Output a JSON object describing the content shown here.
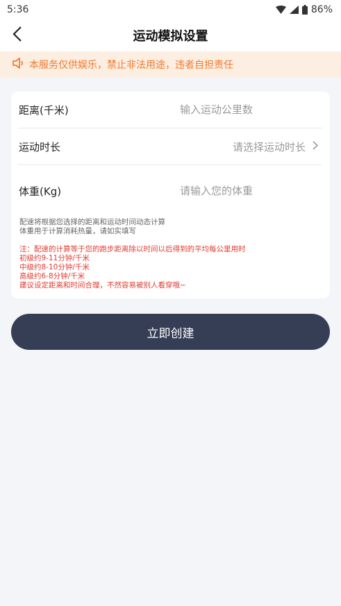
{
  "status_bar": {
    "time": "5:36",
    "battery": "86%"
  },
  "nav": {
    "title": "运动模拟设置"
  },
  "notice": {
    "text": "本服务仅供娱乐，禁止非法用途，违者自担责任"
  },
  "form": {
    "distance": {
      "label": "距离(千米)",
      "placeholder": "输入运动公里数",
      "value": ""
    },
    "duration": {
      "label": "运动时长",
      "placeholder": "请选择运动时长"
    },
    "weight": {
      "label": "体重(Kg)",
      "placeholder": "请输入您的体重",
      "value": ""
    }
  },
  "hints": [
    "配速将根据您选择的距离和运动时间动态计算",
    "体重用于计算消耗热量，请如实填写"
  ],
  "warnings": [
    "注：配速的计算等于您的跑步距离除以时间以后得到的平均每公里用时",
    "初级约9-11分钟/千米",
    "中级约8-10分钟/千米",
    "高级约6-8分钟/千米",
    "建议设定距离和时间合理，不然容易被别人看穿哦~"
  ],
  "create_button": {
    "label": "立即创建"
  },
  "colors": {
    "accent": "#363e56",
    "notice_text": "#f07a2e",
    "notice_bg": "#fdeee2",
    "warning": "#e23a2e",
    "background": "#f4f5f8"
  },
  "icons": [
    "wifi-icon",
    "signal-icon",
    "battery-icon",
    "back-arrow-icon",
    "speaker-icon",
    "chevron-right-icon"
  ]
}
